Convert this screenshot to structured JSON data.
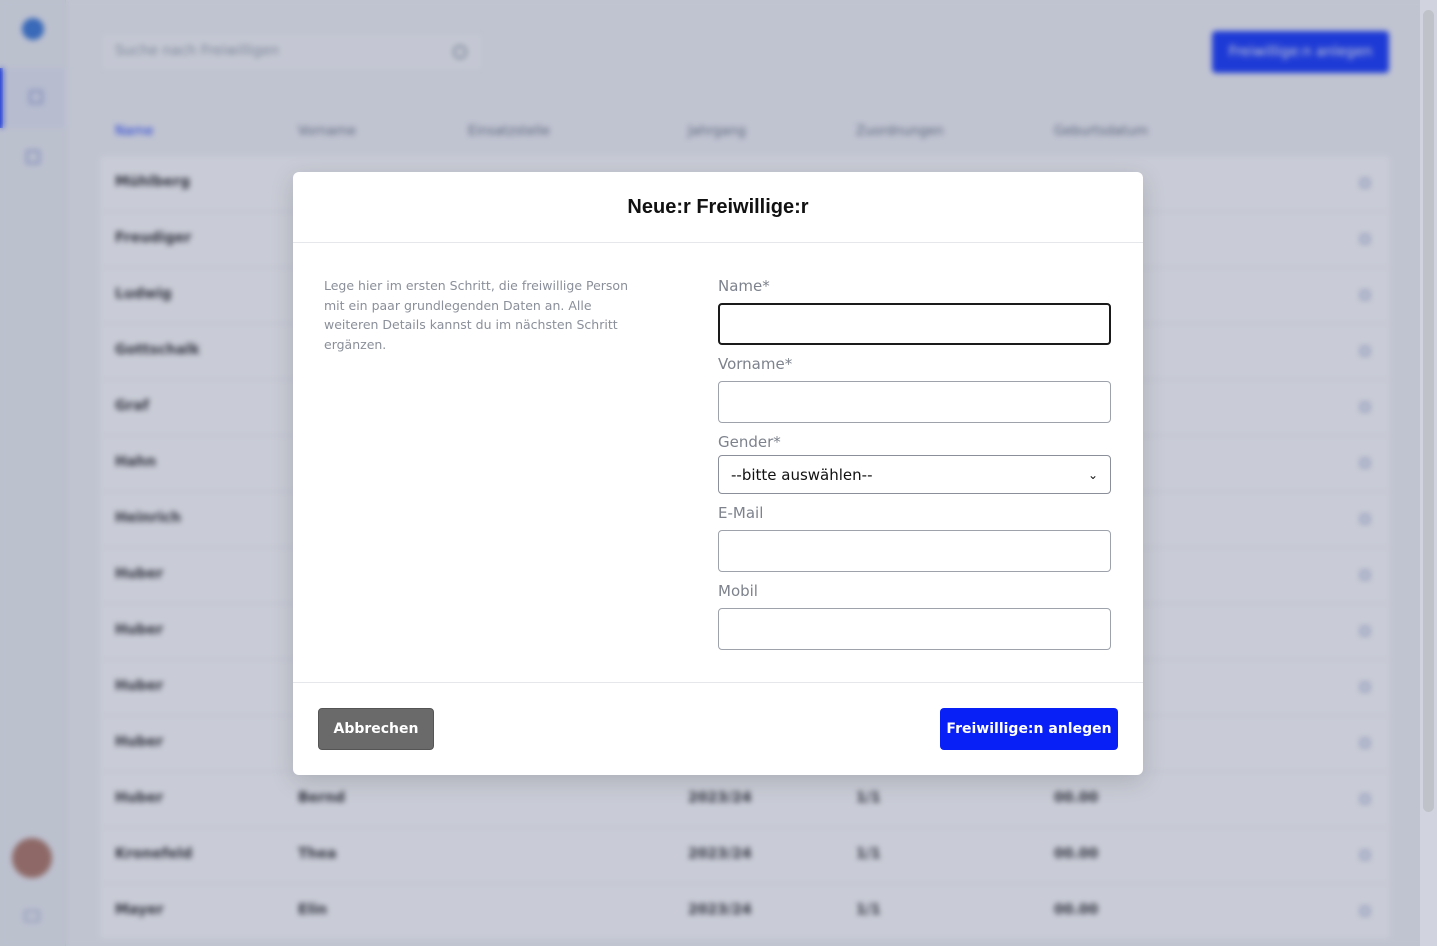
{
  "background": {
    "search_placeholder": "Suche nach Freiwilligen",
    "add_button_label": "Freiwillige:n anlegen",
    "columns": [
      "Name",
      "Vorname",
      "Einsatzstelle",
      "Jahrgang",
      "Zuordnungen",
      "Geburtsdatum"
    ],
    "rows": [
      [
        "Mühlberg",
        "",
        "",
        "",
        "",
        ""
      ],
      [
        "Freudiger",
        "",
        "",
        "",
        "",
        ""
      ],
      [
        "Ludwig",
        "",
        "",
        "",
        "",
        ""
      ],
      [
        "Gottschalk",
        "",
        "",
        "",
        "",
        ""
      ],
      [
        "Graf",
        "",
        "",
        "",
        "",
        ""
      ],
      [
        "Hahn",
        "",
        "",
        "",
        "",
        ""
      ],
      [
        "Heinrich",
        "",
        "",
        "",
        "",
        ""
      ],
      [
        "Huber",
        "",
        "",
        "",
        "",
        ""
      ],
      [
        "Huber",
        "",
        "",
        "",
        "",
        ""
      ],
      [
        "Huber",
        "",
        "",
        "",
        "",
        ""
      ],
      [
        "Huber",
        "",
        "",
        "",
        "",
        ""
      ],
      [
        "Huber",
        "Bernd",
        "",
        "2023/24",
        "1/1",
        "00.00"
      ],
      [
        "Kronefeld",
        "Thea",
        "",
        "2023/24",
        "1/1",
        "00.00"
      ],
      [
        "Mayer",
        "Elin",
        "",
        "2023/24",
        "1/1",
        "00.00"
      ]
    ]
  },
  "modal": {
    "title": "Neue:r Freiwillige:r",
    "intro": "Lege hier im ersten Schritt, die freiwillige Person mit ein paar grundlegenden Daten an. Alle weiteren Details kannst du im nächsten Schritt ergänzen.",
    "fields": {
      "name_label": "Name*",
      "name_value": "",
      "vorname_label": "Vorname*",
      "vorname_value": "",
      "gender_label": "Gender*",
      "gender_selected": "--bitte auswählen--",
      "email_label": "E-Mail",
      "email_value": "",
      "mobil_label": "Mobil",
      "mobil_value": ""
    },
    "cancel_label": "Abbrechen",
    "submit_label": "Freiwillige:n anlegen"
  },
  "colors": {
    "primary": "#0820f5",
    "cancel": "#6a6a6a"
  }
}
